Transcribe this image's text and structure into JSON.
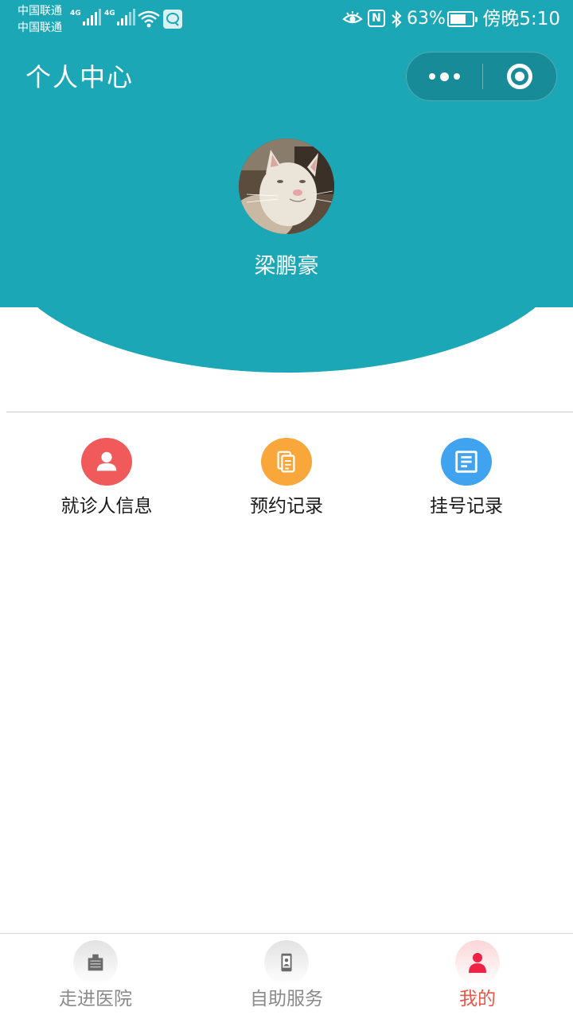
{
  "status_bar": {
    "carrier_1": "中国联通",
    "carrier_2": "中国联通",
    "network_1": "4G",
    "network_2": "4G",
    "battery": "63%",
    "time": "傍晚5:10",
    "nfc_label": "N"
  },
  "nav": {
    "title": "个人中心"
  },
  "profile": {
    "name": "梁鹏豪"
  },
  "menu": [
    {
      "label": "就诊人信息",
      "icon": "user-icon",
      "color": "#f05a5a"
    },
    {
      "label": "预约记录",
      "icon": "documents-icon",
      "color": "#f9a63a"
    },
    {
      "label": "挂号记录",
      "icon": "list-doc-icon",
      "color": "#3fa3f0"
    }
  ],
  "tabs": [
    {
      "label": "走进医院",
      "icon": "hospital-icon",
      "active": false
    },
    {
      "label": "自助服务",
      "icon": "phone-service-icon",
      "active": false
    },
    {
      "label": "我的",
      "icon": "person-icon",
      "active": true
    }
  ],
  "colors": {
    "header": "#1ca7b6",
    "active_tab": "#e8564a",
    "inactive_tab": "#8a8a8a"
  }
}
